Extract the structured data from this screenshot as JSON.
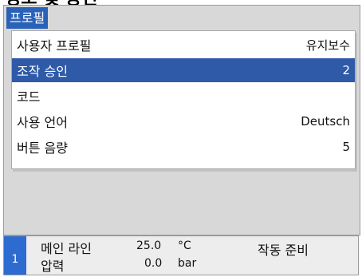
{
  "header": {
    "title": "정보 및 승인"
  },
  "menu": {
    "title": "프로필",
    "items": [
      {
        "label": "사용자 프로필",
        "value": "유지보수"
      },
      {
        "label": "조작 승인",
        "value": "2"
      },
      {
        "label": "코드",
        "value": ""
      },
      {
        "label": "사용 언어",
        "value": "Deutsch"
      },
      {
        "label": "버튼 음량",
        "value": "5"
      }
    ],
    "selected_index": 1
  },
  "status": {
    "index": "1",
    "line1_label": "메인 라인",
    "line1_value": "25.0",
    "line1_unit": "°C",
    "line2_label": "압력",
    "line2_value": "0.0",
    "line2_unit": "bar",
    "state": "작동 준비"
  },
  "colors": {
    "accent": "#2e5aa8",
    "status_index": "#2e6bd0"
  }
}
